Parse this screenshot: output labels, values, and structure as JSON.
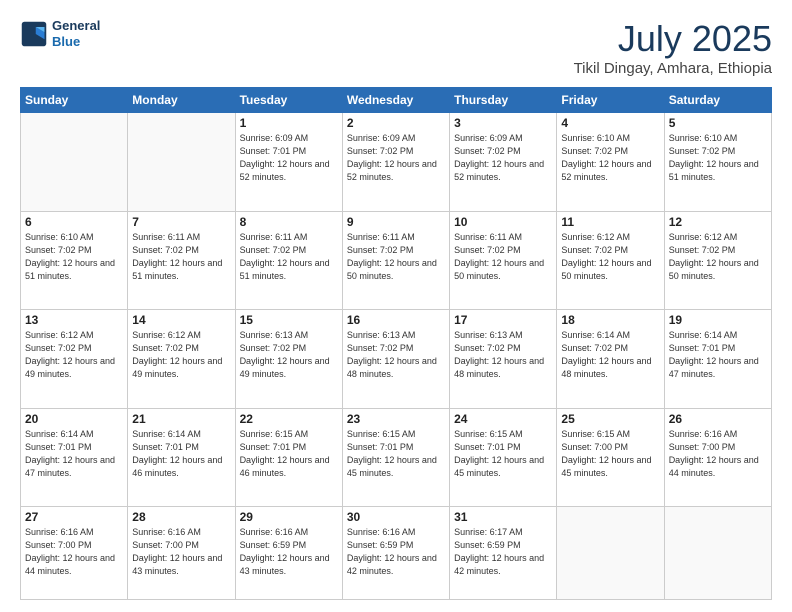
{
  "header": {
    "logo_line1": "General",
    "logo_line2": "Blue",
    "title": "July 2025",
    "subtitle": "Tikil Dingay, Amhara, Ethiopia"
  },
  "weekdays": [
    "Sunday",
    "Monday",
    "Tuesday",
    "Wednesday",
    "Thursday",
    "Friday",
    "Saturday"
  ],
  "weeks": [
    [
      {
        "day": "",
        "info": ""
      },
      {
        "day": "",
        "info": ""
      },
      {
        "day": "1",
        "info": "Sunrise: 6:09 AM\nSunset: 7:01 PM\nDaylight: 12 hours and 52 minutes."
      },
      {
        "day": "2",
        "info": "Sunrise: 6:09 AM\nSunset: 7:02 PM\nDaylight: 12 hours and 52 minutes."
      },
      {
        "day": "3",
        "info": "Sunrise: 6:09 AM\nSunset: 7:02 PM\nDaylight: 12 hours and 52 minutes."
      },
      {
        "day": "4",
        "info": "Sunrise: 6:10 AM\nSunset: 7:02 PM\nDaylight: 12 hours and 52 minutes."
      },
      {
        "day": "5",
        "info": "Sunrise: 6:10 AM\nSunset: 7:02 PM\nDaylight: 12 hours and 51 minutes."
      }
    ],
    [
      {
        "day": "6",
        "info": "Sunrise: 6:10 AM\nSunset: 7:02 PM\nDaylight: 12 hours and 51 minutes."
      },
      {
        "day": "7",
        "info": "Sunrise: 6:11 AM\nSunset: 7:02 PM\nDaylight: 12 hours and 51 minutes."
      },
      {
        "day": "8",
        "info": "Sunrise: 6:11 AM\nSunset: 7:02 PM\nDaylight: 12 hours and 51 minutes."
      },
      {
        "day": "9",
        "info": "Sunrise: 6:11 AM\nSunset: 7:02 PM\nDaylight: 12 hours and 50 minutes."
      },
      {
        "day": "10",
        "info": "Sunrise: 6:11 AM\nSunset: 7:02 PM\nDaylight: 12 hours and 50 minutes."
      },
      {
        "day": "11",
        "info": "Sunrise: 6:12 AM\nSunset: 7:02 PM\nDaylight: 12 hours and 50 minutes."
      },
      {
        "day": "12",
        "info": "Sunrise: 6:12 AM\nSunset: 7:02 PM\nDaylight: 12 hours and 50 minutes."
      }
    ],
    [
      {
        "day": "13",
        "info": "Sunrise: 6:12 AM\nSunset: 7:02 PM\nDaylight: 12 hours and 49 minutes."
      },
      {
        "day": "14",
        "info": "Sunrise: 6:12 AM\nSunset: 7:02 PM\nDaylight: 12 hours and 49 minutes."
      },
      {
        "day": "15",
        "info": "Sunrise: 6:13 AM\nSunset: 7:02 PM\nDaylight: 12 hours and 49 minutes."
      },
      {
        "day": "16",
        "info": "Sunrise: 6:13 AM\nSunset: 7:02 PM\nDaylight: 12 hours and 48 minutes."
      },
      {
        "day": "17",
        "info": "Sunrise: 6:13 AM\nSunset: 7:02 PM\nDaylight: 12 hours and 48 minutes."
      },
      {
        "day": "18",
        "info": "Sunrise: 6:14 AM\nSunset: 7:02 PM\nDaylight: 12 hours and 48 minutes."
      },
      {
        "day": "19",
        "info": "Sunrise: 6:14 AM\nSunset: 7:01 PM\nDaylight: 12 hours and 47 minutes."
      }
    ],
    [
      {
        "day": "20",
        "info": "Sunrise: 6:14 AM\nSunset: 7:01 PM\nDaylight: 12 hours and 47 minutes."
      },
      {
        "day": "21",
        "info": "Sunrise: 6:14 AM\nSunset: 7:01 PM\nDaylight: 12 hours and 46 minutes."
      },
      {
        "day": "22",
        "info": "Sunrise: 6:15 AM\nSunset: 7:01 PM\nDaylight: 12 hours and 46 minutes."
      },
      {
        "day": "23",
        "info": "Sunrise: 6:15 AM\nSunset: 7:01 PM\nDaylight: 12 hours and 45 minutes."
      },
      {
        "day": "24",
        "info": "Sunrise: 6:15 AM\nSunset: 7:01 PM\nDaylight: 12 hours and 45 minutes."
      },
      {
        "day": "25",
        "info": "Sunrise: 6:15 AM\nSunset: 7:00 PM\nDaylight: 12 hours and 45 minutes."
      },
      {
        "day": "26",
        "info": "Sunrise: 6:16 AM\nSunset: 7:00 PM\nDaylight: 12 hours and 44 minutes."
      }
    ],
    [
      {
        "day": "27",
        "info": "Sunrise: 6:16 AM\nSunset: 7:00 PM\nDaylight: 12 hours and 44 minutes."
      },
      {
        "day": "28",
        "info": "Sunrise: 6:16 AM\nSunset: 7:00 PM\nDaylight: 12 hours and 43 minutes."
      },
      {
        "day": "29",
        "info": "Sunrise: 6:16 AM\nSunset: 6:59 PM\nDaylight: 12 hours and 43 minutes."
      },
      {
        "day": "30",
        "info": "Sunrise: 6:16 AM\nSunset: 6:59 PM\nDaylight: 12 hours and 42 minutes."
      },
      {
        "day": "31",
        "info": "Sunrise: 6:17 AM\nSunset: 6:59 PM\nDaylight: 12 hours and 42 minutes."
      },
      {
        "day": "",
        "info": ""
      },
      {
        "day": "",
        "info": ""
      }
    ]
  ]
}
